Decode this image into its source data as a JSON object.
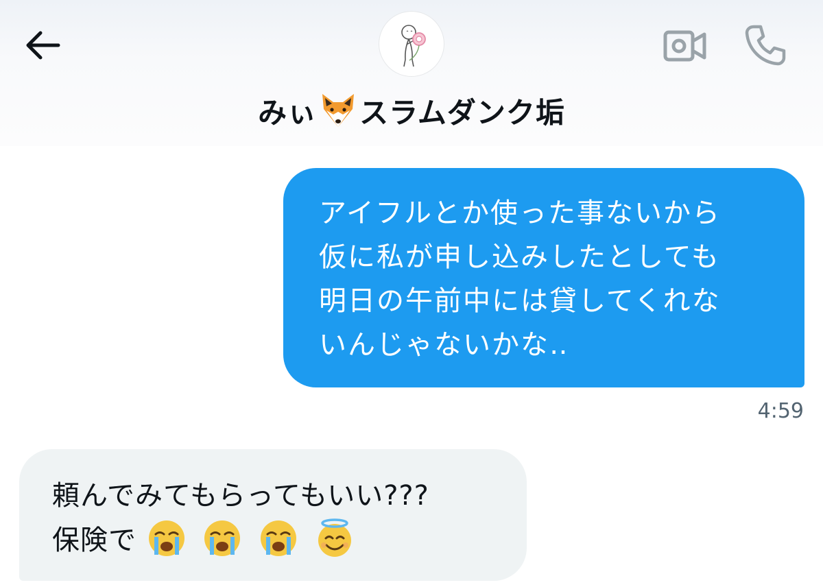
{
  "header": {
    "contact_name_before": "みぃ",
    "contact_name_after": "スラムダンク垢",
    "name_emoji": "fox-face-icon"
  },
  "messages": [
    {
      "direction": "outgoing",
      "text": "アイフルとか使った事ないから\n仮に私が申し込みしたとしても\n明日の午前中には貸してくれな\nいんじゃないかな‥",
      "time": "4:59",
      "bubble_color": "#1d9bf0"
    },
    {
      "direction": "incoming",
      "line1": "頼んでみてもらってもいい???",
      "line2": "保険で",
      "emojis": [
        "loudly-crying-face-icon",
        "loudly-crying-face-icon",
        "loudly-crying-face-icon",
        "smiling-face-with-halo-icon"
      ],
      "bubble_color": "#eff3f4"
    }
  ],
  "colors": {
    "accent": "#1d9bf0",
    "text": "#0f1419",
    "secondary_text": "#536471",
    "icon_gray": "#9aa3a9"
  }
}
